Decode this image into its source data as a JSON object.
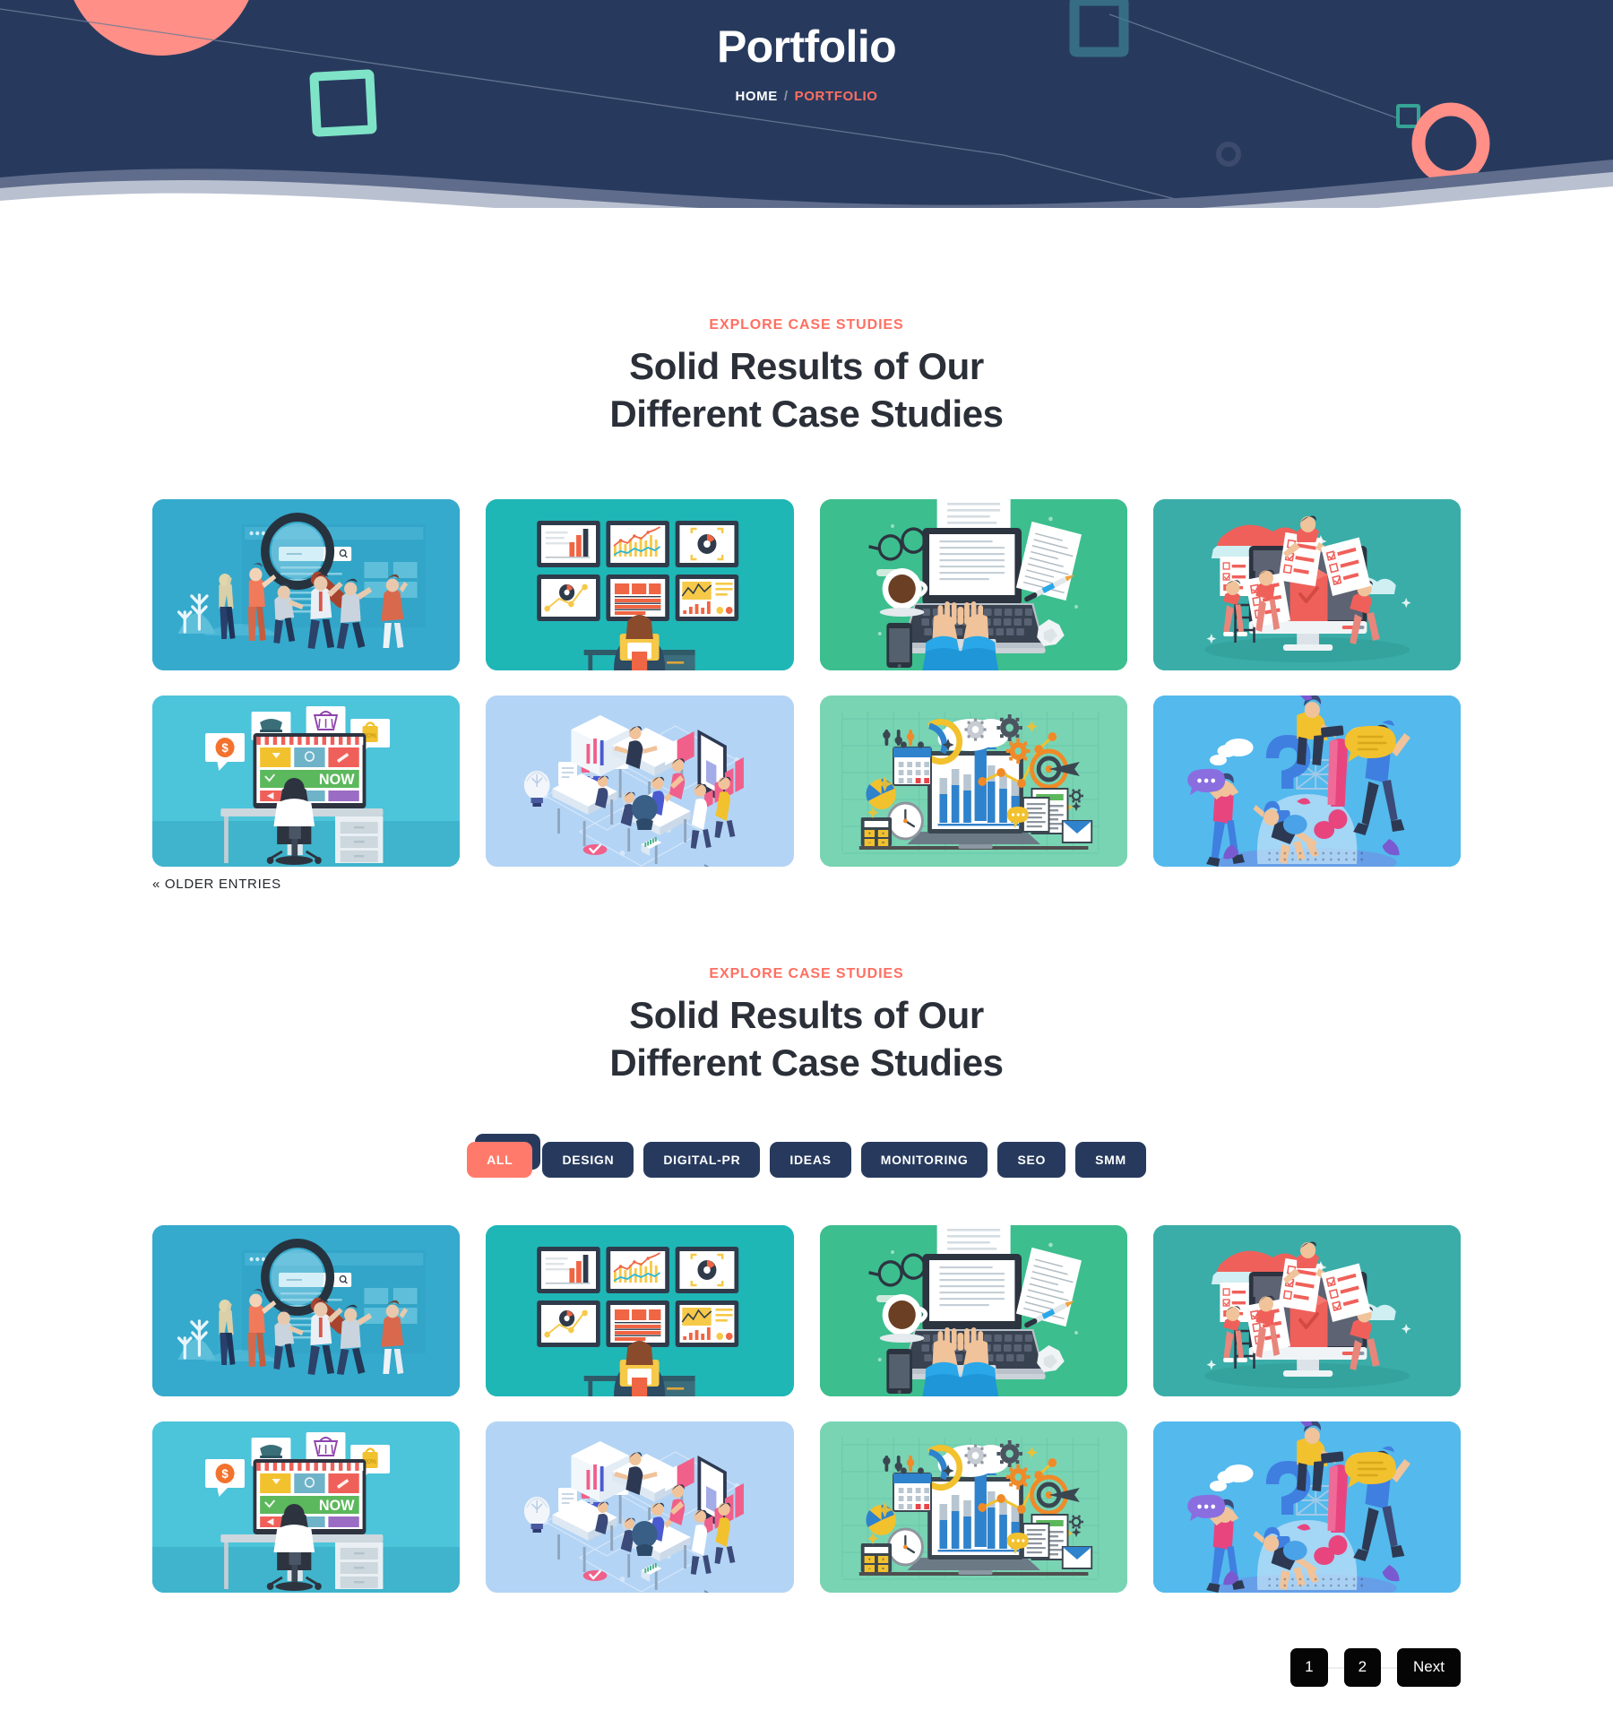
{
  "banner": {
    "title": "Portfolio",
    "breadcrumb": {
      "home": "HOME",
      "separator": "/",
      "current": "PORTFOLIO"
    },
    "colors": {
      "bg": "#273a5e",
      "accent_coral": "#ff6f61",
      "accent_teal": "#7fe3c8",
      "wave_dark": "#5f6c8b",
      "wave_light": "#b9c0d0"
    }
  },
  "sections": [
    {
      "eyebrow": "EXPLORE CASE STUDIES",
      "title_line1": "Solid Results of Our",
      "title_line2": "Different Case Studies",
      "has_filters": false,
      "footer_link": "« OLDER ENTRIES"
    },
    {
      "eyebrow": "EXPLORE CASE STUDIES",
      "title_line1": "Solid Results of Our",
      "title_line2": "Different Case Studies",
      "has_filters": true
    }
  ],
  "filters": [
    {
      "label": "ALL",
      "active": true
    },
    {
      "label": "DESIGN",
      "active": false
    },
    {
      "label": "DIGITAL-PR",
      "active": false
    },
    {
      "label": "IDEAS",
      "active": false
    },
    {
      "label": "MONITORING",
      "active": false
    },
    {
      "label": "SEO",
      "active": false
    },
    {
      "label": "SMM",
      "active": false
    }
  ],
  "gallery": [
    {
      "name": "seo-search-team",
      "bg": "#35aacd",
      "alt": "Team with magnifying glass over search bar"
    },
    {
      "name": "analytics-monitoring-wall",
      "bg": "#1fb6b6",
      "alt": "Person watching wall of chart monitors"
    },
    {
      "name": "content-writing-laptop",
      "bg": "#3cbe8e",
      "alt": "Top-down laptop with hands typing"
    },
    {
      "name": "online-survey-checklist",
      "bg": "#3aada8",
      "alt": "People filling survey forms at monitor"
    },
    {
      "name": "ecommerce-shopping",
      "bg": "#4cc4da",
      "alt": "Person shopping online at desk"
    },
    {
      "name": "isometric-office-team",
      "bg": "#b3d4f5",
      "alt": "Isometric office workspace with team"
    },
    {
      "name": "business-data-growth",
      "bg": "#79d4b4",
      "alt": "Laptop with bar chart and growth arrow"
    },
    {
      "name": "faq-question-answer",
      "bg": "#54b9ed",
      "alt": "People around question and exclamation marks"
    }
  ],
  "pagination": {
    "pages": [
      "1",
      "2"
    ],
    "next_label": "Next"
  }
}
